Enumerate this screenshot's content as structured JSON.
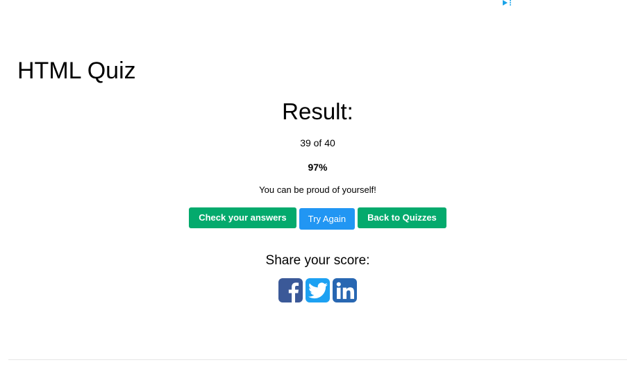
{
  "ad": {
    "icon": "adchoices-icon",
    "color": "#1aa3e8"
  },
  "quiz": {
    "title": "HTML Quiz"
  },
  "result": {
    "heading": "Result:",
    "score": "39 of 40",
    "percent": "97%",
    "percent_value": 97,
    "message": "You can be proud of yourself!"
  },
  "buttons": {
    "check_answers": "Check your answers",
    "try_again": "Try Again",
    "back_to_quizzes": "Back to Quizzes"
  },
  "share": {
    "heading": "Share your score:",
    "networks": [
      {
        "name": "facebook",
        "icon": "facebook-icon",
        "color": "#3b5998"
      },
      {
        "name": "twitter",
        "icon": "twitter-icon",
        "color": "#1da1f2"
      },
      {
        "name": "linkedin",
        "icon": "linkedin-icon",
        "color": "#2867b2"
      }
    ]
  },
  "colors": {
    "green": "#04aa6d",
    "blue": "#2196f3"
  }
}
